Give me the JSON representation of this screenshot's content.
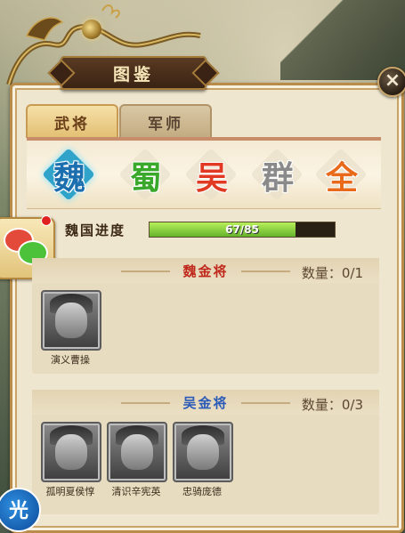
{
  "window": {
    "title": "图鉴",
    "close_label": "×"
  },
  "tabs": [
    {
      "label": "武将",
      "active": true
    },
    {
      "label": "军师",
      "active": false
    }
  ],
  "factions": [
    {
      "label": "魏",
      "selected": true
    },
    {
      "label": "蜀",
      "selected": false
    },
    {
      "label": "吴",
      "selected": false
    },
    {
      "label": "群",
      "selected": false
    },
    {
      "label": "全",
      "selected": false
    }
  ],
  "progress": {
    "label": "魏国进度",
    "text": "67/85",
    "value": 67,
    "max": 85
  },
  "sections": [
    {
      "title": "魏金将",
      "title_color": "#c0281c",
      "count": "数量：0/1",
      "heroes": [
        {
          "name": "演义曹操",
          "icon": "hero-portrait-icon"
        }
      ]
    },
    {
      "title": "吴金将",
      "title_color": "#2a5ab8",
      "count": "数量：0/3",
      "heroes": [
        {
          "name": "孤明夏侯惇",
          "icon": "hero-portrait-icon"
        },
        {
          "name": "清识辛宪英",
          "icon": "hero-portrait-icon"
        },
        {
          "name": "忠骑庞德",
          "icon": "hero-portrait-icon"
        }
      ]
    }
  ],
  "chat": {
    "icon": "chat-bubbles-icon",
    "has_notification": true
  },
  "bottom_badge": {
    "label": "光"
  },
  "colors": {
    "panel": "#efe6cf",
    "panel_border": "#b98c4a",
    "progress_fill": "#8ad23e"
  }
}
